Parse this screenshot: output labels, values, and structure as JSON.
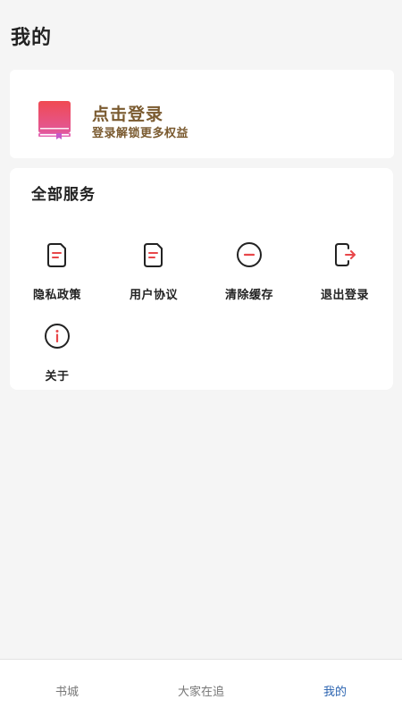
{
  "page": {
    "title": "我的"
  },
  "login": {
    "title": "点击登录",
    "subtitle": "登录解锁更多权益",
    "icon": "book-icon"
  },
  "services": {
    "title": "全部服务",
    "items": [
      {
        "label": "隐私政策",
        "icon": "document-icon"
      },
      {
        "label": "用户协议",
        "icon": "document-icon"
      },
      {
        "label": "清除缓存",
        "icon": "minus-circle-icon"
      },
      {
        "label": "退出登录",
        "icon": "logout-icon"
      },
      {
        "label": "关于",
        "icon": "info-icon"
      }
    ]
  },
  "tabs": [
    {
      "label": "书城",
      "active": false
    },
    {
      "label": "大家在追",
      "active": false
    },
    {
      "label": "我的",
      "active": true
    }
  ],
  "colors": {
    "accent_red": "#e8474a",
    "login_text": "#7a5a2f",
    "active_tab": "#2a63b0",
    "background": "#f5f5f5"
  }
}
